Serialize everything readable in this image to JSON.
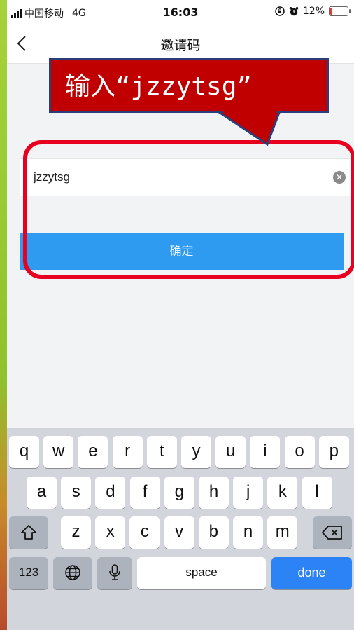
{
  "status_bar": {
    "carrier": "中国移动",
    "network": "4G",
    "time": "16:03",
    "battery": "12%",
    "battery_level": 0.12
  },
  "nav": {
    "title": "邀请码"
  },
  "form": {
    "code_value": "jzzytsg",
    "confirm_label": "确定"
  },
  "annotation": {
    "text": "输入“jzzytsg”",
    "color": "#c00000"
  },
  "keyboard": {
    "row1": [
      "q",
      "w",
      "e",
      "r",
      "t",
      "y",
      "u",
      "i",
      "o",
      "p"
    ],
    "row2": [
      "a",
      "s",
      "d",
      "f",
      "g",
      "h",
      "j",
      "k",
      "l"
    ],
    "row3": [
      "z",
      "x",
      "c",
      "v",
      "b",
      "n",
      "m"
    ],
    "numbers_label": "123",
    "space_label": "space",
    "done_label": "done",
    "icons": [
      "shift-icon",
      "backspace-icon",
      "globe-icon",
      "microphone-icon"
    ]
  },
  "colors": {
    "accent": "#2e9bf0",
    "done_key": "#2c83f5",
    "highlight": "#e8001e"
  }
}
